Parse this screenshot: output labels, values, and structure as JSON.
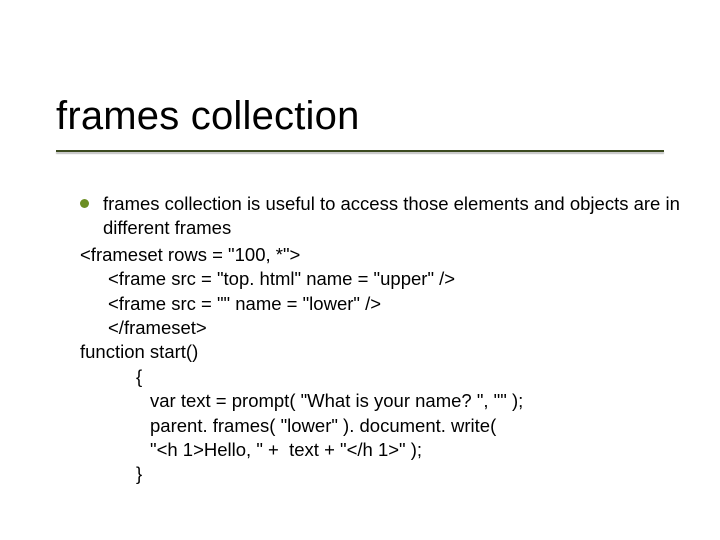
{
  "title": "frames collection",
  "bullet": "frames collection is useful to access those elements and objects are in different frames",
  "code": {
    "l1": "<frameset rows = \"100, *\">",
    "l2": "<frame src = \"top. html\" name = \"upper\" />",
    "l3": "<frame src = \"\" name = \"lower\" />",
    "l4": "</frameset>",
    "l5": "function start()",
    "l6": "{",
    "l7": "var text = prompt( \"What is your name? \", \"\" );",
    "l8": "parent. frames( \"lower\" ). document. write(",
    "l9": "\"<h 1>Hello, \" +  text + \"</h 1>\" );",
    "l10": "}"
  }
}
